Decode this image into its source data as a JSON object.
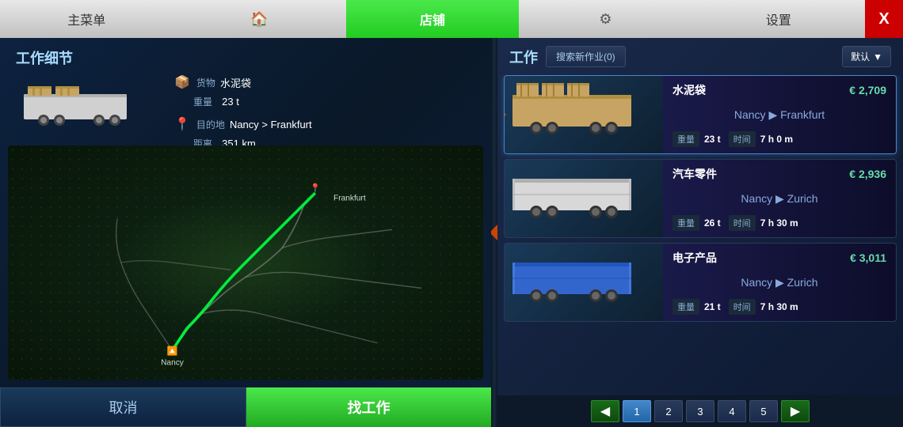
{
  "nav": {
    "items": [
      {
        "id": "main-menu",
        "label": "主菜单",
        "active": false
      },
      {
        "id": "home",
        "label": "🏠",
        "active": false
      },
      {
        "id": "shop",
        "label": "店铺",
        "active": true
      },
      {
        "id": "settings-gear",
        "label": "⚙",
        "active": false
      },
      {
        "id": "settings",
        "label": "设置",
        "active": false
      }
    ],
    "close_label": "X"
  },
  "left": {
    "title": "工作细节",
    "cargo_icon": "📦",
    "cargo_label": "货物",
    "cargo_value": "水泥袋",
    "weight_label": "重量",
    "weight_value": "23 t",
    "dest_icon": "📍",
    "dest_label": "目的地",
    "dest_value": "Nancy > Frankfurt",
    "dist_label": "距离",
    "dist_value": "351 km",
    "city_start": "Nancy",
    "city_end": "Frankfurt",
    "btn_cancel": "取消",
    "btn_find": "找工作"
  },
  "right": {
    "title": "工作",
    "filter_label": "搜索新作业(0)",
    "sort_label": "默认",
    "jobs": [
      {
        "id": "job-1",
        "cargo": "水泥袋",
        "price": "€ 2,709",
        "from": "Nancy",
        "to": "Frankfurt",
        "weight": "23 t",
        "time": "7 h 0 m",
        "selected": true,
        "trailer_color": "tan"
      },
      {
        "id": "job-2",
        "cargo": "汽车零件",
        "price": "€ 2,936",
        "from": "Nancy",
        "to": "Zurich",
        "weight": "26 t",
        "time": "7 h 30 m",
        "selected": false,
        "trailer_color": "silver"
      },
      {
        "id": "job-3",
        "cargo": "电子产品",
        "price": "€ 3,011",
        "from": "Nancy",
        "to": "Zurich",
        "weight": "21 t",
        "time": "7 h 30 m",
        "selected": false,
        "trailer_color": "blue"
      }
    ],
    "pagination": {
      "current": 1,
      "pages": [
        "1",
        "2",
        "3",
        "4",
        "5"
      ]
    },
    "labels": {
      "weight": "重量",
      "time": "时间",
      "arrow": "▶"
    }
  }
}
